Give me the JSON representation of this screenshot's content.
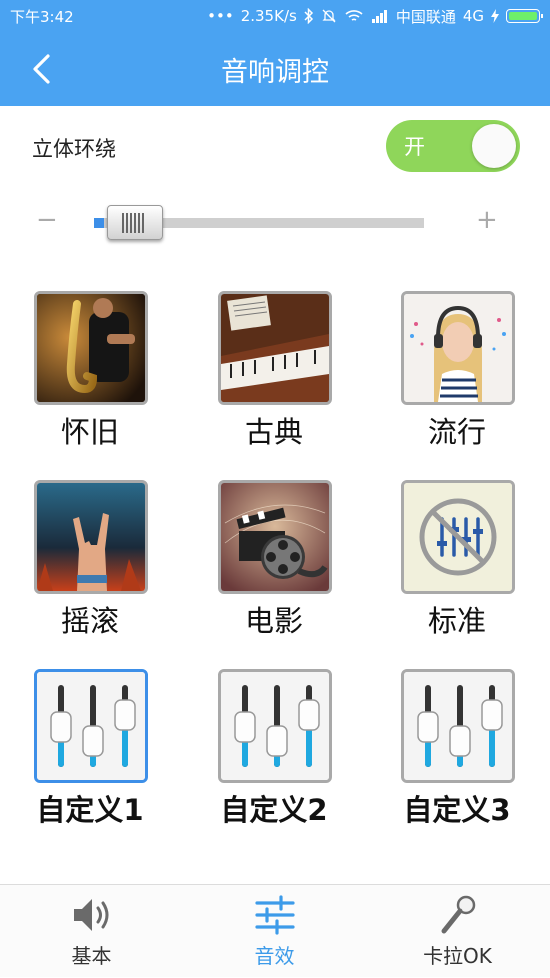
{
  "status_bar": {
    "time": "下午3:42",
    "dots": "•••",
    "speed": "2.35K/s",
    "carrier": "中国联通",
    "network": "4G",
    "icons": [
      "bluetooth-icon",
      "mute-icon",
      "wifi-icon",
      "signal-icon",
      "charging-icon",
      "battery-icon"
    ]
  },
  "header": {
    "title": "音响调控",
    "back_icon": "chevron-left-icon"
  },
  "surround": {
    "label": "立体环绕",
    "toggle_text": "开",
    "toggle_on": true
  },
  "volume": {
    "minus": "−",
    "plus": "+",
    "level": 0.05
  },
  "presets": [
    {
      "label": "怀旧",
      "icon": "saxophone-photo"
    },
    {
      "label": "古典",
      "icon": "piano-photo"
    },
    {
      "label": "流行",
      "icon": "headphones-girl-photo"
    },
    {
      "label": "摇滚",
      "icon": "rock-hand-photo"
    },
    {
      "label": "电影",
      "icon": "film-clapper-icon"
    },
    {
      "label": "标准",
      "icon": "no-equalizer-icon"
    },
    {
      "label": "自定义1",
      "icon": "equalizer-sliders-icon",
      "selected": true
    },
    {
      "label": "自定义2",
      "icon": "equalizer-sliders-icon"
    },
    {
      "label": "自定义3",
      "icon": "equalizer-sliders-icon"
    }
  ],
  "bottom_nav": [
    {
      "label": "基本",
      "icon": "speaker-icon"
    },
    {
      "label": "音效",
      "icon": "equalizer-icon",
      "active": true
    },
    {
      "label": "卡拉OK",
      "icon": "microphone-icon"
    }
  ],
  "colors": {
    "header": "#4aa3f2",
    "toggle_on": "#8fd65a",
    "accent": "#3d8fe8",
    "tab_active": "#3d9be9"
  }
}
